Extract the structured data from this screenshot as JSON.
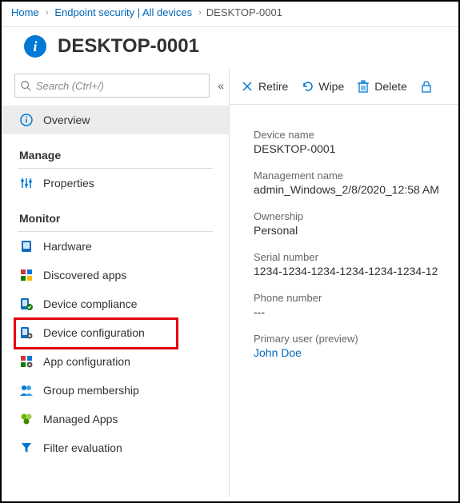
{
  "breadcrumb": {
    "home": "Home",
    "second": "Endpoint security | All devices",
    "current": "DESKTOP-0001"
  },
  "header": {
    "title": "DESKTOP-0001"
  },
  "search": {
    "placeholder": "Search (Ctrl+/)"
  },
  "sidebar": {
    "overview": "Overview",
    "group_manage": "Manage",
    "properties": "Properties",
    "group_monitor": "Monitor",
    "hardware": "Hardware",
    "discovered_apps": "Discovered apps",
    "device_compliance": "Device compliance",
    "device_configuration": "Device configuration",
    "app_configuration": "App configuration",
    "group_membership": "Group membership",
    "managed_apps": "Managed Apps",
    "filter_evaluation": "Filter evaluation"
  },
  "toolbar": {
    "retire": "Retire",
    "wipe": "Wipe",
    "delete": "Delete"
  },
  "details": {
    "device_name_label": "Device name",
    "device_name_value": "DESKTOP-0001",
    "management_name_label": "Management name",
    "management_name_value": "admin_Windows_2/8/2020_12:58 AM",
    "ownership_label": "Ownership",
    "ownership_value": "Personal",
    "serial_label": "Serial number",
    "serial_value": "1234-1234-1234-1234-1234-1234-12",
    "phone_label": "Phone number",
    "phone_value": "---",
    "primary_user_label": "Primary user (preview)",
    "primary_user_value": "John Doe"
  }
}
